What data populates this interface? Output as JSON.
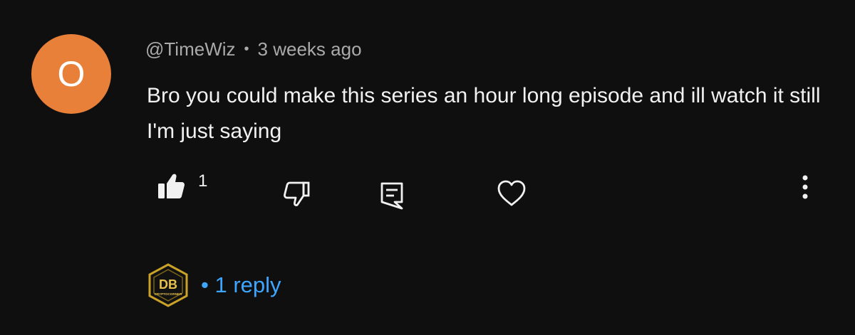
{
  "comment": {
    "avatar_letter": "O",
    "avatar_color": "#e8803a",
    "author": "@TimeWiz",
    "separator": "•",
    "timestamp": "3 weeks ago",
    "text": "Bro you could make this series an hour long episode and ill watch it still I'm just saying",
    "like_count": "1"
  },
  "icons": {
    "like": "thumbs-up-filled-icon",
    "dislike": "thumbs-down-icon",
    "reply": "reply-comment-icon",
    "heart": "heart-icon",
    "more": "more-vertical-icon"
  },
  "replies": {
    "badge_text": "DB",
    "badge_caption": "CRYPTOCORNER",
    "badge_color": "#c9a227",
    "bullet": "•",
    "label": "1 reply",
    "link_color": "#3ea6ff"
  }
}
